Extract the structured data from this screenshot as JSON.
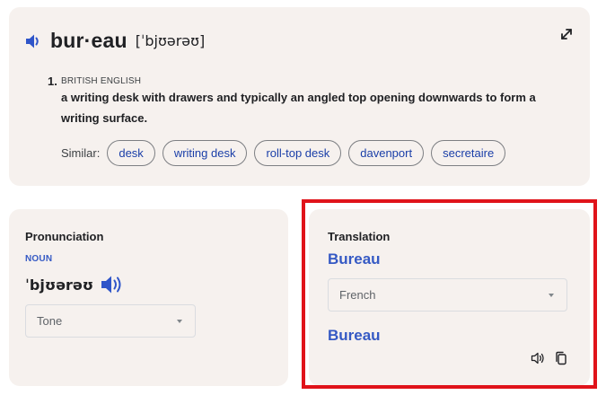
{
  "definition": {
    "headword": "bur·eau",
    "ipa": "[ˈbjʊərəʊ]",
    "senses": [
      {
        "number": "1.",
        "region": "BRITISH ENGLISH",
        "text": "a writing desk with drawers and typically an angled top opening downwards to form a writing surface."
      }
    ],
    "similar_label": "Similar:",
    "similar": [
      "desk",
      "writing desk",
      "roll-top desk",
      "davenport",
      "secretaire"
    ],
    "icons": {
      "audio": "speaker-icon",
      "expand": "expand-icon"
    }
  },
  "pronunciation": {
    "title": "Pronunciation",
    "part_of_speech": "NOUN",
    "ipa": "ˈbjʊərəʊ",
    "tone_select": {
      "value": "Tone"
    }
  },
  "translation": {
    "title": "Translation",
    "source_word": "Bureau",
    "language_select": {
      "value": "French"
    },
    "result": "Bureau",
    "icons": {
      "listen": "speaker-outline-icon",
      "copy": "copy-icon"
    }
  },
  "colors": {
    "card_bg": "#f6f1ee",
    "accent_blue": "#3559c4",
    "link_blue": "#1a3ea8",
    "highlight_red": "#e0131a"
  }
}
